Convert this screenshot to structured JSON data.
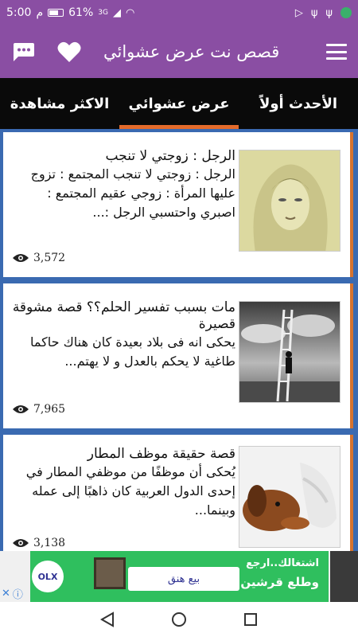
{
  "status_bar": {
    "time": "5:00",
    "am_pm": "م",
    "battery_percent": "61%",
    "network": "3G"
  },
  "app_bar": {
    "title": "قصص نت عرض عشوائي"
  },
  "tabs": [
    {
      "label": "الأحدث أولاً",
      "active": false
    },
    {
      "label": "عرض عشوائي",
      "active": true
    },
    {
      "label": "الاكثر مشاهدة",
      "active": false
    }
  ],
  "stories": [
    {
      "title": "الرجل : زوجتي لا تنجب",
      "excerpt": "الرجل : زوجتي لا تنجب المجتمع : تزوج عليها المرأة : زوجي عقيم المجتمع : اصبري واحتسبي الرجل :...",
      "views": "3,572"
    },
    {
      "title": "مات بسبب تفسير الحلم؟؟ قصة مشوقة قصيرة",
      "excerpt": "يحكى انه فى بلاد بعيدة كان هناك حاكما طاغية لا يحكم بالعدل و لا يهتم...",
      "views": "7,965"
    },
    {
      "title": "قصة حقيقة موظف المطار",
      "excerpt": "يُحكى أن موظفًا من موظفي المطار في إحدى الدول العربية كان ذاهبًا إلى عمله وبينما...",
      "views": "3,138"
    }
  ],
  "ad": {
    "brand": "OLX",
    "button_label": "بيع هنق",
    "line1": "اشتغالك..ارجع",
    "line2": "وطلع قرشين زيادة"
  },
  "colors": {
    "primary": "#8a4ea3",
    "tab_bar": "#0a0a0a",
    "tab_indicator": "#e36b2b",
    "list_bg": "#3a6ab1",
    "card_accent": "#d5732f"
  }
}
